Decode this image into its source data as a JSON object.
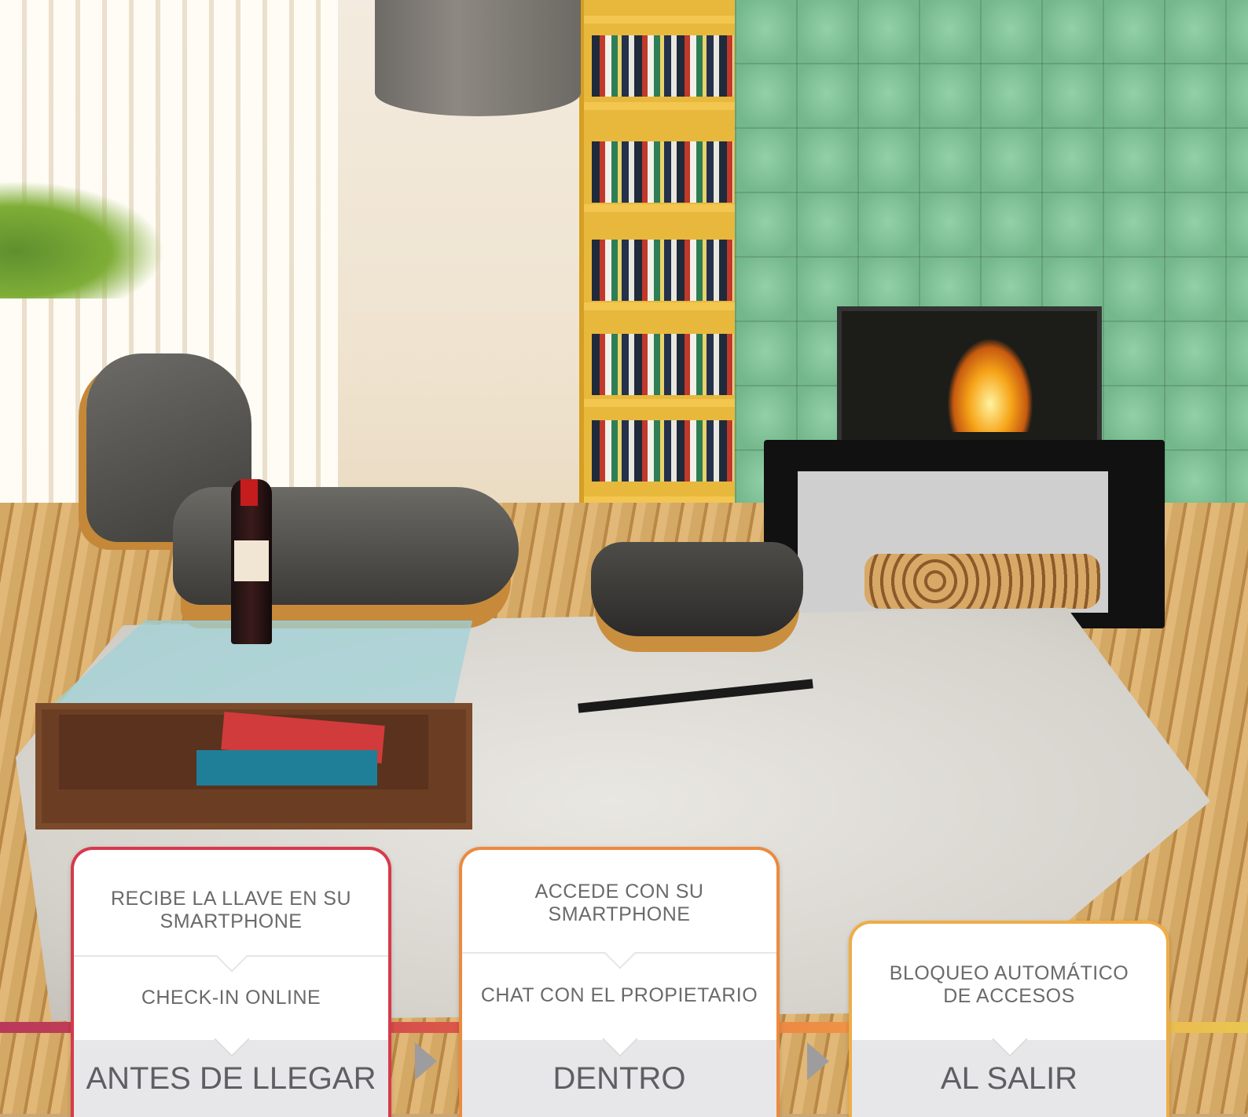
{
  "steps": [
    {
      "primary": "RECIBE LA LLAVE EN SU SMARTPHONE",
      "secondary": "CHECK-IN ONLINE",
      "title": "ANTES DE LLEGAR",
      "border_color": "#d63a4c"
    },
    {
      "primary": "ACCEDE CON SU SMARTPHONE",
      "secondary": "CHAT CON EL PROPIETARIO",
      "title": "DENTRO",
      "border_color": "#ec8a3f"
    },
    {
      "primary": "BLOQUEO AUTOMÁTICO DE ACCESOS",
      "title": "AL SALIR",
      "border_color": "#efad45"
    }
  ],
  "colors": {
    "timeline_start": "#b9395a",
    "timeline_end": "#e8c652",
    "arrow": "#9d9d9f"
  },
  "icons": [
    "next-step-arrow-icon",
    "next-step-arrow-icon"
  ]
}
